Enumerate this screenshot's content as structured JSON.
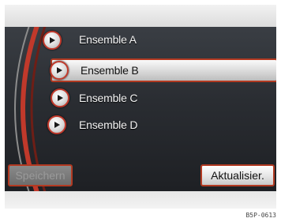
{
  "list": {
    "items": [
      {
        "label": "Ensemble A",
        "selected": false
      },
      {
        "label": "Ensemble B",
        "selected": true
      },
      {
        "label": "Ensemble C",
        "selected": false
      },
      {
        "label": "Ensemble D",
        "selected": false
      }
    ]
  },
  "buttons": {
    "save_label": "Speichern",
    "save_enabled": false,
    "update_label": "Aktualisier.",
    "update_enabled": true
  },
  "image_code": "B5P-0613",
  "icons": {
    "list_item": "play-icon"
  },
  "colors": {
    "accent": "#c0392b",
    "panel": "#2a2d32"
  }
}
